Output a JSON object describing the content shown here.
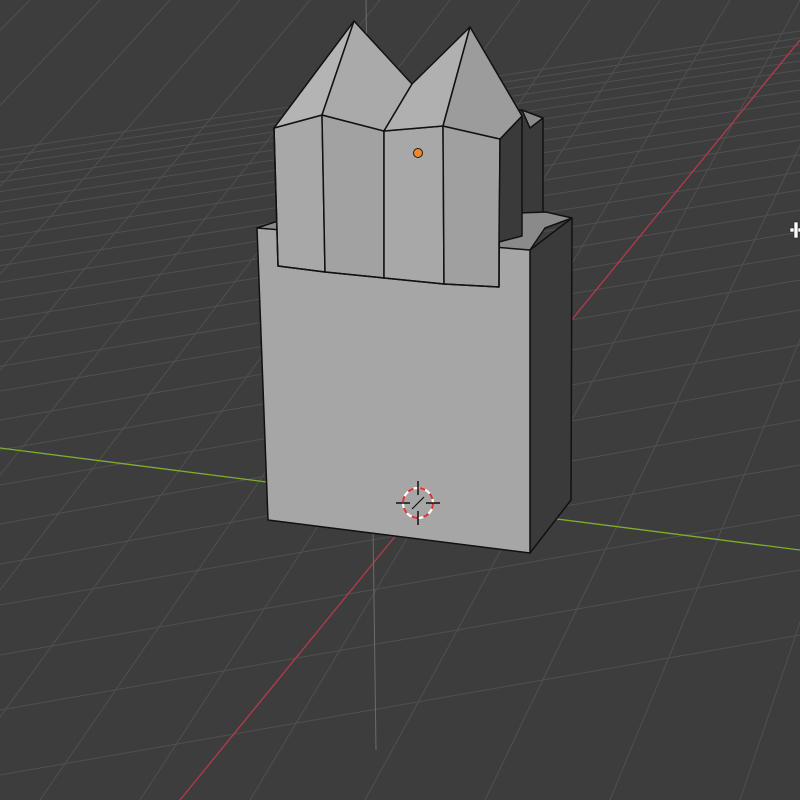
{
  "viewport": {
    "background_color": "#3d3d3d",
    "grid_color": "#505050",
    "x_axis_color": "#b63a4a",
    "y_axis_color": "#7fae2e",
    "z_axis_color": "#6b6b6b",
    "edge_color": "#111111"
  },
  "object": {
    "type": "mesh",
    "face_colors": {
      "front": "#a6a6a6",
      "side": "#3a3a3a",
      "top": "#8a8a8a",
      "roof_light": "#b4b4b4",
      "roof_dark": "#9c9c9c"
    },
    "origin_color": "#f0882a"
  },
  "cursor_3d": {
    "ring_colors": [
      "#d43a3a",
      "#ffffff"
    ]
  },
  "icons": {
    "origin": "origin-dot-icon",
    "cursor": "3d-cursor-icon",
    "edge_widget": "move-crosshair-icon"
  }
}
